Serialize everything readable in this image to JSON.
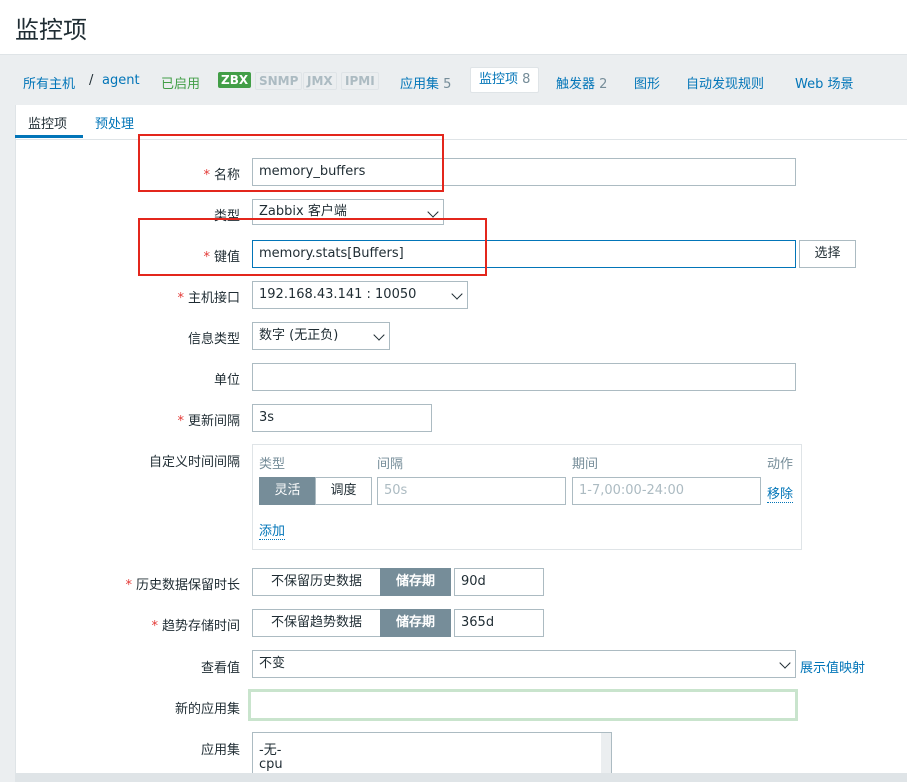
{
  "page": {
    "title": "监控项"
  },
  "nav": {
    "all_hosts": "所有主机",
    "sep": "/",
    "host": "agent",
    "status": "已启用",
    "tags": [
      "ZBX",
      "SNMP",
      "JMX",
      "IPMI"
    ],
    "applications": "应用集",
    "applications_count": "5",
    "items": "监控项",
    "items_count": "8",
    "triggers": "触发器",
    "triggers_count": "2",
    "graphs": "图形",
    "discovery": "自动发现规则",
    "web": "Web 场景"
  },
  "tabs": {
    "item": "监控项",
    "preprocessing": "预处理"
  },
  "form": {
    "name_label": "名称",
    "name_value": "memory_buffers",
    "type_label": "类型",
    "type_value": "Zabbix 客户端",
    "key_label": "键值",
    "key_value": "memory.stats[Buffers]",
    "select_button": "选择",
    "interface_label": "主机接口",
    "interface_value": "192.168.43.141 : 10050",
    "info_type_label": "信息类型",
    "info_type_value": "数字 (无正负)",
    "units_label": "单位",
    "units_value": "",
    "interval_label": "更新间隔",
    "interval_value": "3s",
    "custom_label": "自定义时间间隔",
    "custom_col_type": "类型",
    "custom_col_interval": "间隔",
    "custom_col_period": "期间",
    "custom_col_action": "动作",
    "custom_flexible": "灵活",
    "custom_scheduling": "调度",
    "custom_interval_placeholder": "50s",
    "custom_period_placeholder": "1-7,00:00-24:00",
    "custom_remove": "移除",
    "custom_add": "添加",
    "history_label": "历史数据保留时长",
    "history_no_keep": "不保留历史数据",
    "history_storage": "储存期",
    "history_value": "90d",
    "trends_label": "趋势存储时间",
    "trends_no_keep": "不保留趋势数据",
    "trends_storage": "储存期",
    "trends_value": "365d",
    "show_value_label": "查看值",
    "show_value_value": "不变",
    "value_mapping_link": "展示值映射",
    "new_app_label": "新的应用集",
    "new_app_value": "",
    "apps_label": "应用集",
    "apps_list": [
      "-无-",
      "cpu"
    ]
  },
  "colors": {
    "accent": "#0275b8",
    "required": "#e33734",
    "annotation": "#e3261c",
    "enabled": "#429e47"
  }
}
